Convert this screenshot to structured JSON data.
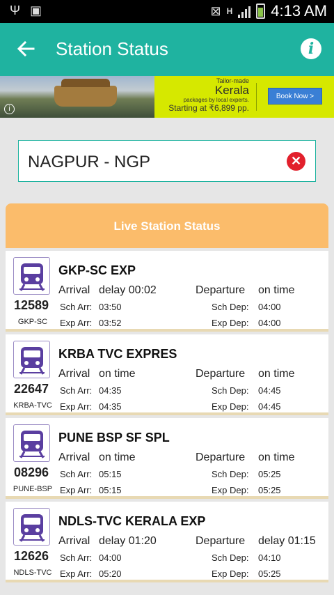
{
  "status_bar": {
    "time": "4:13 AM",
    "network": "H"
  },
  "app_bar": {
    "title": "Station Status",
    "back_icon": "arrow-left-icon",
    "info_icon": "info-icon",
    "info_glyph": "i",
    "accent": "#1fb3a0"
  },
  "ad": {
    "tag": "Tailor-made",
    "title": "Kerala",
    "sub": "packages by local experts.",
    "price": "Starting at ₹6,899 pp.",
    "button": "Book Now >"
  },
  "search": {
    "value": "NAGPUR - NGP",
    "clear_icon": "close-circle-icon"
  },
  "live_status": {
    "header": "Live Station Status",
    "header_color": "#fbbc6b"
  },
  "labels": {
    "arrival": "Arrival",
    "departure": "Departure",
    "sch_arr": "Sch Arr:",
    "exp_arr": "Exp Arr:",
    "sch_dep": "Sch Dep:",
    "exp_dep": "Exp Dep:"
  },
  "trains": [
    {
      "number": "12589",
      "code": "GKP-SC",
      "name": "GKP-SC EXP",
      "arrival": "delay 00:02",
      "departure": "on time",
      "sch_arr": "03:50",
      "exp_arr": "03:52",
      "sch_dep": "04:00",
      "exp_dep": "04:00"
    },
    {
      "number": "22647",
      "code": "KRBA-TVC",
      "name": "KRBA TVC EXPRES",
      "arrival": "on time",
      "departure": "on time",
      "sch_arr": "04:35",
      "exp_arr": "04:35",
      "sch_dep": "04:45",
      "exp_dep": "04:45"
    },
    {
      "number": "08296",
      "code": "PUNE-BSP",
      "name": "PUNE BSP SF SPL",
      "arrival": "on time",
      "departure": "on time",
      "sch_arr": "05:15",
      "exp_arr": "05:15",
      "sch_dep": "05:25",
      "exp_dep": "05:25"
    },
    {
      "number": "12626",
      "code": "NDLS-TVC",
      "name": "NDLS-TVC KERALA EXP",
      "arrival": "delay 01:20",
      "departure": "delay 01:15",
      "sch_arr": "04:00",
      "exp_arr": "05:20",
      "sch_dep": "04:10",
      "exp_dep": "05:25"
    }
  ]
}
